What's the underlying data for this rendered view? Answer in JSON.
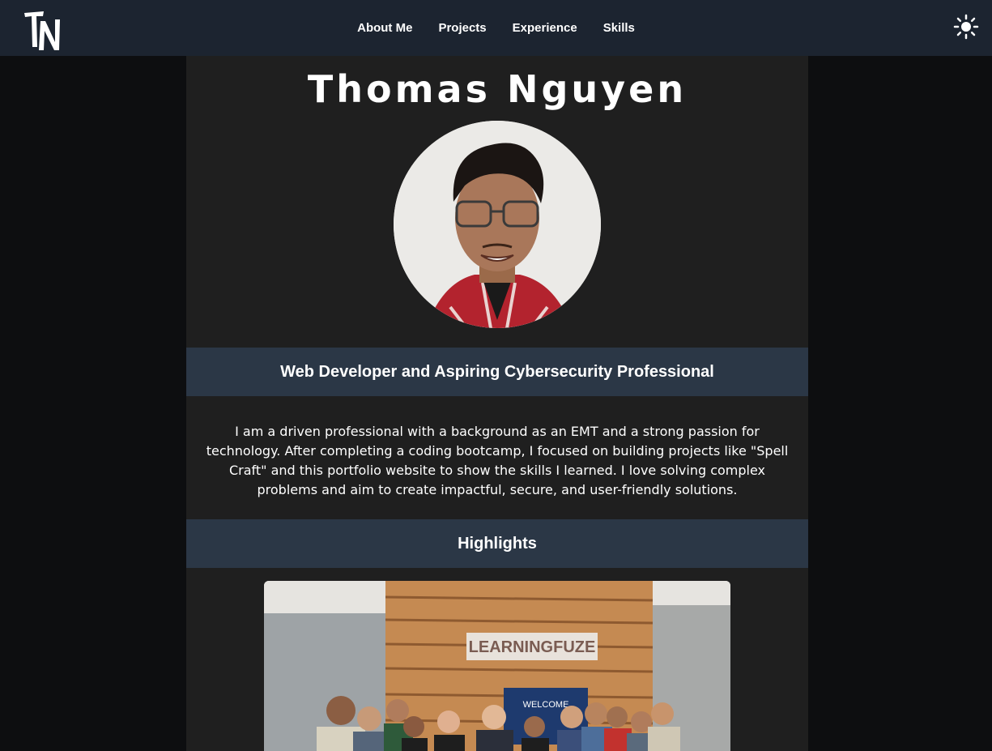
{
  "header": {
    "logo_text": "TN",
    "nav": [
      {
        "label": "About Me"
      },
      {
        "label": "Projects"
      },
      {
        "label": "Experience"
      },
      {
        "label": "Skills"
      }
    ],
    "theme_toggle_icon": "sun-icon"
  },
  "profile": {
    "name": "Thomas Nguyen",
    "subtitle": "Web Developer and Aspiring Cybersecurity Professional",
    "bio": "I am a driven professional with a background as an EMT and a strong passion for technology. After completing a coding bootcamp, I focused on building projects like \"Spell Craft\" and this portfolio website to show the skills I learned. I love solving complex problems and aim to create impactful, secure, and user-friendly solutions."
  },
  "highlights": {
    "heading": "Highlights",
    "photo_sign_text": "LEARNINGFUZE",
    "photo_screen_text": "WELCOME"
  },
  "colors": {
    "navbar": "#1c2430",
    "page_bg": "#0d0e10",
    "content_bg": "#1f1f1f",
    "band": "#2b3746",
    "text": "#ffffff"
  }
}
